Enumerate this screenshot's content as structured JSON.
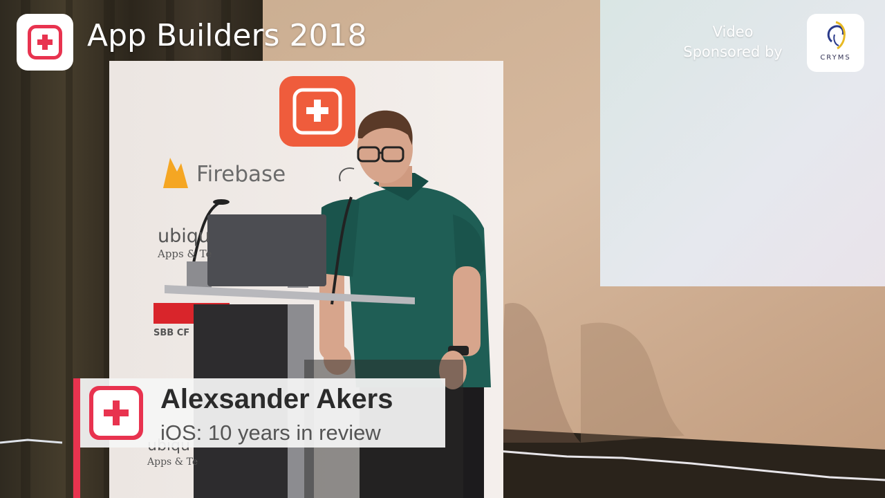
{
  "overlay": {
    "event_title": "App Builders 2018",
    "sponsor_line1": "Video",
    "sponsor_line2": "Sponsored by",
    "sponsor_logo_text": "CRYMS"
  },
  "lower_third": {
    "speaker_name": "Alexsander Akers",
    "talk_title": "iOS: 10 years in review"
  },
  "banner": {
    "firebase": "Firebase",
    "ubiqu": "ubiqu",
    "apps": "Apps & Te",
    "sbb": "SBB CF",
    "ubiqu_lower": "ubiqu",
    "apps_lower": "Apps & Te"
  },
  "colors": {
    "accent": "#e8334f",
    "brand_orange": "#ef5c3c",
    "firebase_yellow": "#f5a623",
    "shirt": "#1f5e55"
  }
}
